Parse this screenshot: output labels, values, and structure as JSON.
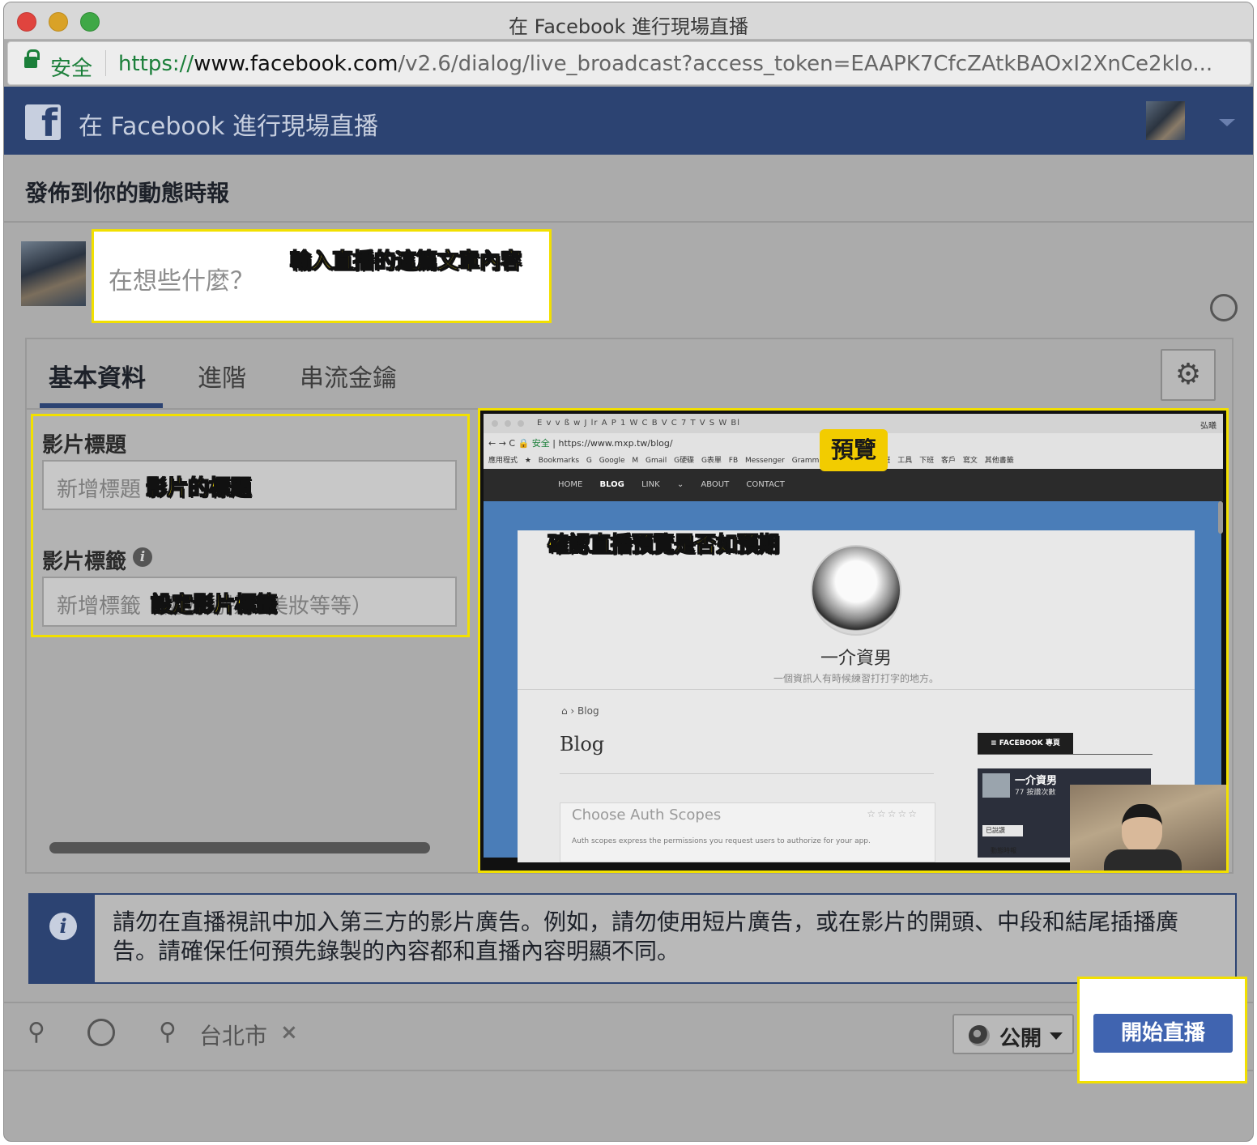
{
  "window": {
    "title": "在 Facebook 進行現場直播"
  },
  "addressbar": {
    "secure_label": "安全",
    "url_scheme": "https://",
    "url_host": "www.facebook.com",
    "url_path": "/v2.6/dialog/live_broadcast?access_token=EAAPK7CfcZAtkBAOxI2XnCe2klo..."
  },
  "header": {
    "title": "在 Facebook 進行現場直播",
    "logo_glyph": "f"
  },
  "post": {
    "section_title": "發佈到你的動態時報",
    "composer_placeholder": "在想些什麼？"
  },
  "tabs": [
    {
      "label": "基本資料",
      "active": true
    },
    {
      "label": "進階",
      "active": false
    },
    {
      "label": "串流金鑰",
      "active": false
    }
  ],
  "form": {
    "title_label": "影片標題",
    "title_placeholder": "新增標題",
    "tags_label": "影片標籤",
    "tags_placeholder": "新增標籤（例如動物、美妝等等）"
  },
  "preview": {
    "badge": "預覽",
    "browser": {
      "tab_strip": "E  v  v  ß  w  J  lr  A  P  1  W  C  B  V  C  7  T  V  S  W  Bl",
      "user": "弘曦",
      "secure": "安全",
      "url": "https://www.mxp.tw/blog/",
      "bookmarks": "應用程式  ★ Bookmarks  G Google  M Gmail  G硬碟  G表單  FB Messenger  Grammar  [重新啟動]  上班  工具  下班  客戶  寫文  其他書籤"
    },
    "site": {
      "nav": [
        "HOME",
        "BLOG",
        "LINK ⌄",
        "ABOUT",
        "CONTACT"
      ],
      "active_nav": "BLOG",
      "name": "一介資男",
      "tagline": "一個資訊人有時候練習打打字的地方。",
      "breadcrumb": "⌂  ›  Blog",
      "heading": "Blog",
      "post_title": "Choose Auth Scopes",
      "post_stars": "☆☆☆☆☆",
      "post_excerpt": "Auth scopes express the permissions you request users to authorize for your app.",
      "widget_title": "≡ FACEBOOK 專頁",
      "widget_page_name": "一介資男",
      "widget_page_sub": "77 按讚次數",
      "widget_like": "已說讚",
      "widget_timeline": "動態時報"
    }
  },
  "annotations": {
    "composer": "輸入直播的這篇文章內容",
    "title": "影片的標題",
    "tags": "設定影片標籤",
    "preview": "確認直播預覽是否如預期"
  },
  "notice": {
    "text": "請勿在直播視訊中加入第三方的影片廣告。例如，請勿使用短片廣告，或在影片的開頭、中段和結尾插播廣告。請確保任何預先錄製的內容都和直播內容明顯不同。"
  },
  "footer": {
    "location": "台北市",
    "remove_location": "×",
    "privacy": "公開",
    "go_live": "開始直播"
  },
  "colors": {
    "facebook_blue": "#2c4372",
    "button_blue": "#4064b0",
    "annotation_yellow": "#f2e000",
    "secure_green": "#1b7f3a"
  }
}
